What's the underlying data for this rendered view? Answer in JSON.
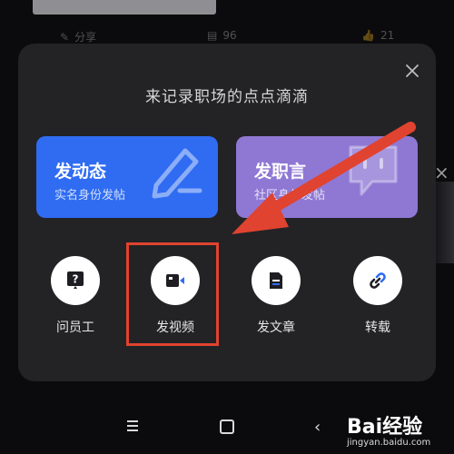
{
  "background": {
    "share_label": "分享",
    "comment_count": "96",
    "like_count": "21"
  },
  "sheet": {
    "title": "来记录职场的点点滴滴",
    "close_icon": "close-icon"
  },
  "cards": [
    {
      "title": "发动态",
      "subtitle": "实名身份发帖",
      "color": "#2f6cf2",
      "icon": "pencil-icon"
    },
    {
      "title": "发职言",
      "subtitle": "社区身份发帖",
      "color": "#8f78d4",
      "icon": "chat-bubble-icon"
    }
  ],
  "actions": [
    {
      "label": "问员工",
      "icon": "question-icon"
    },
    {
      "label": "发视频",
      "icon": "video-camera-icon"
    },
    {
      "label": "发文章",
      "icon": "document-icon"
    },
    {
      "label": "转载",
      "icon": "link-icon"
    }
  ],
  "annotation": {
    "highlight_color": "#e0432f",
    "target": "发视频"
  },
  "watermark": {
    "logo": "Bai经验",
    "url": "jingyan.baidu.com"
  }
}
